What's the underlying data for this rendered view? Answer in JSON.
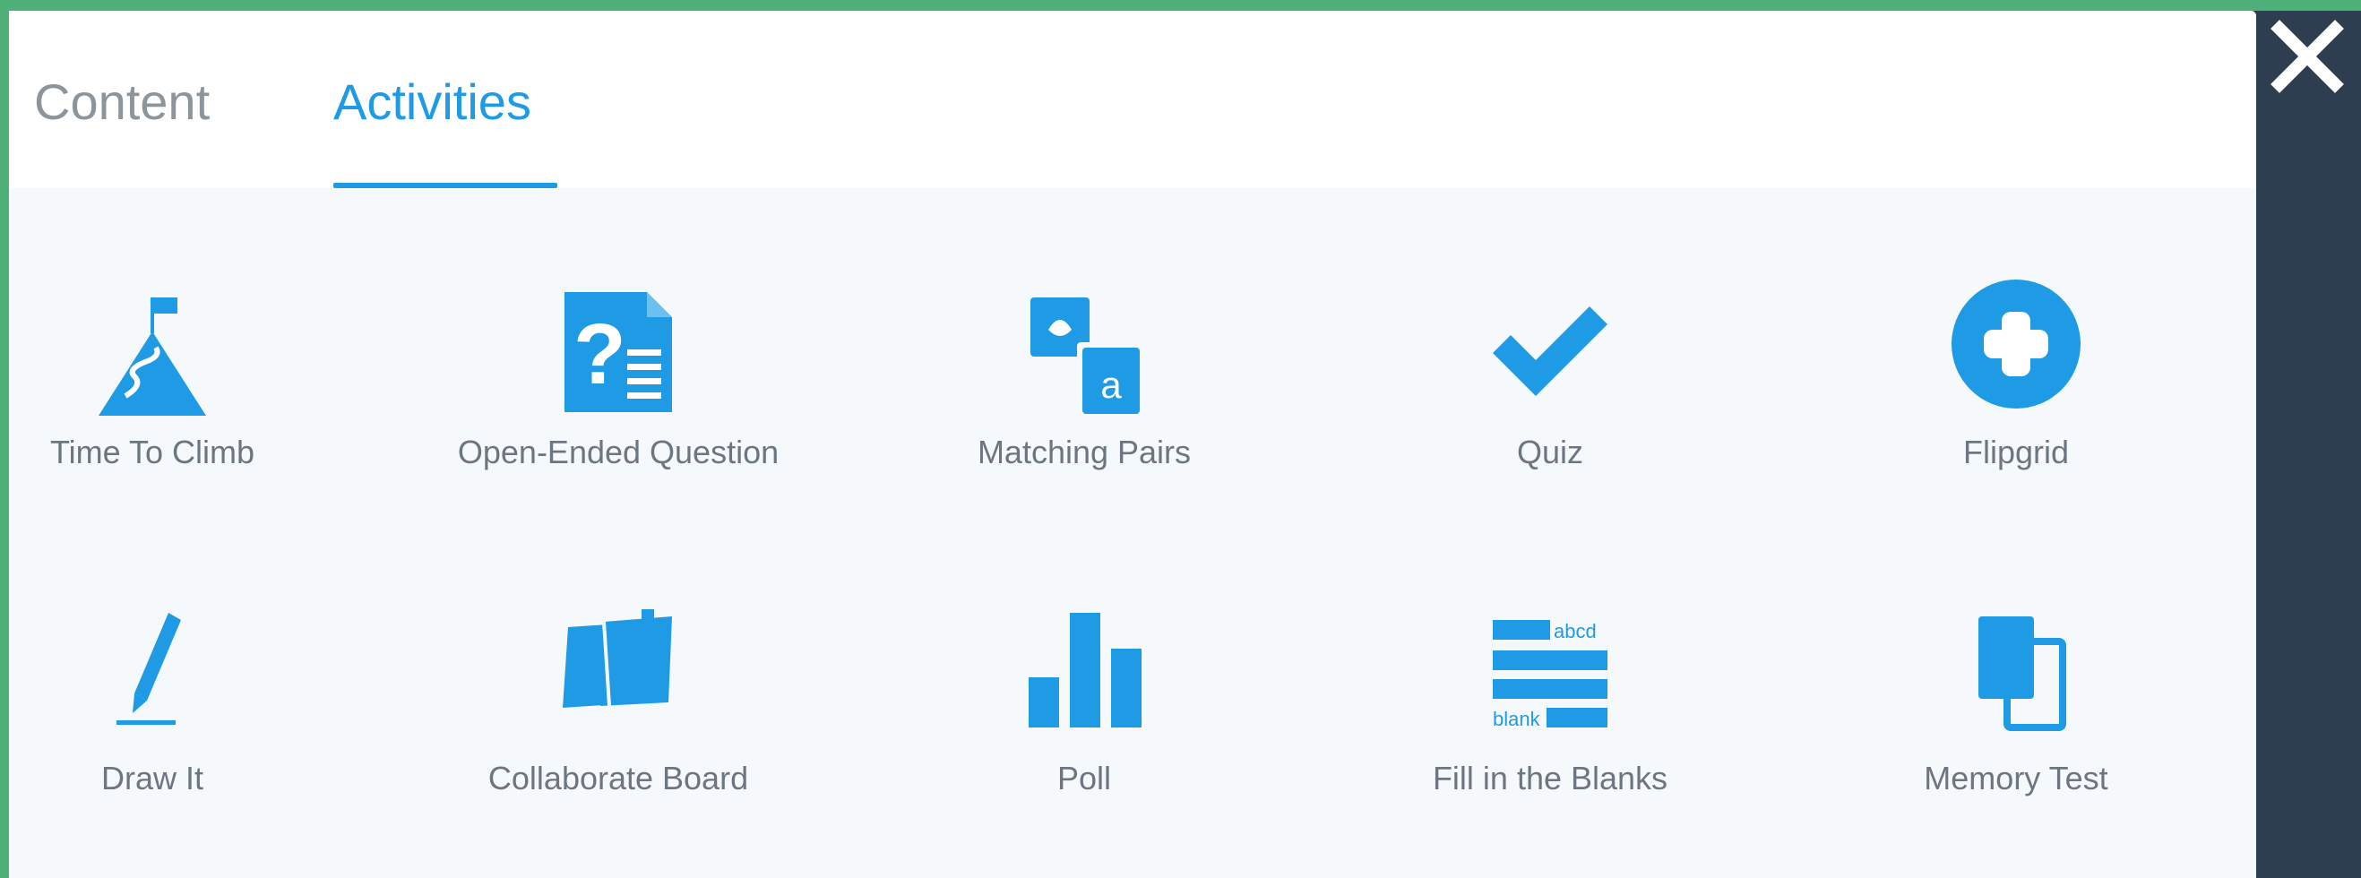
{
  "tabs": [
    {
      "label": "Content",
      "active": false
    },
    {
      "label": "Activities",
      "active": true
    }
  ],
  "colors": {
    "accent": "#1f9be6",
    "inactive_tab": "#8c959c",
    "label": "#6c7680",
    "panel_bg": "#f6f9fc",
    "side_bg": "#2c3e4f",
    "frame": "#4fb07a"
  },
  "close_icon": "close-icon",
  "activities": [
    {
      "label": "Time To Climb",
      "icon": "mountain-flag-icon"
    },
    {
      "label": "Open-Ended Question",
      "icon": "question-document-icon"
    },
    {
      "label": "Matching Pairs",
      "icon": "matching-pairs-icon"
    },
    {
      "label": "Quiz",
      "icon": "checkmark-icon"
    },
    {
      "label": "Flipgrid",
      "icon": "plus-circle-icon"
    },
    {
      "label": "Draw It",
      "icon": "pencil-icon"
    },
    {
      "label": "Collaborate Board",
      "icon": "board-icon"
    },
    {
      "label": "Poll",
      "icon": "bar-chart-icon"
    },
    {
      "label": "Fill in the Blanks",
      "icon": "fill-blanks-icon"
    },
    {
      "label": "Memory Test",
      "icon": "memory-cards-icon"
    }
  ],
  "icon_text": {
    "matching_letter": "a",
    "fill_top": "abcd",
    "fill_bottom": "blank"
  }
}
